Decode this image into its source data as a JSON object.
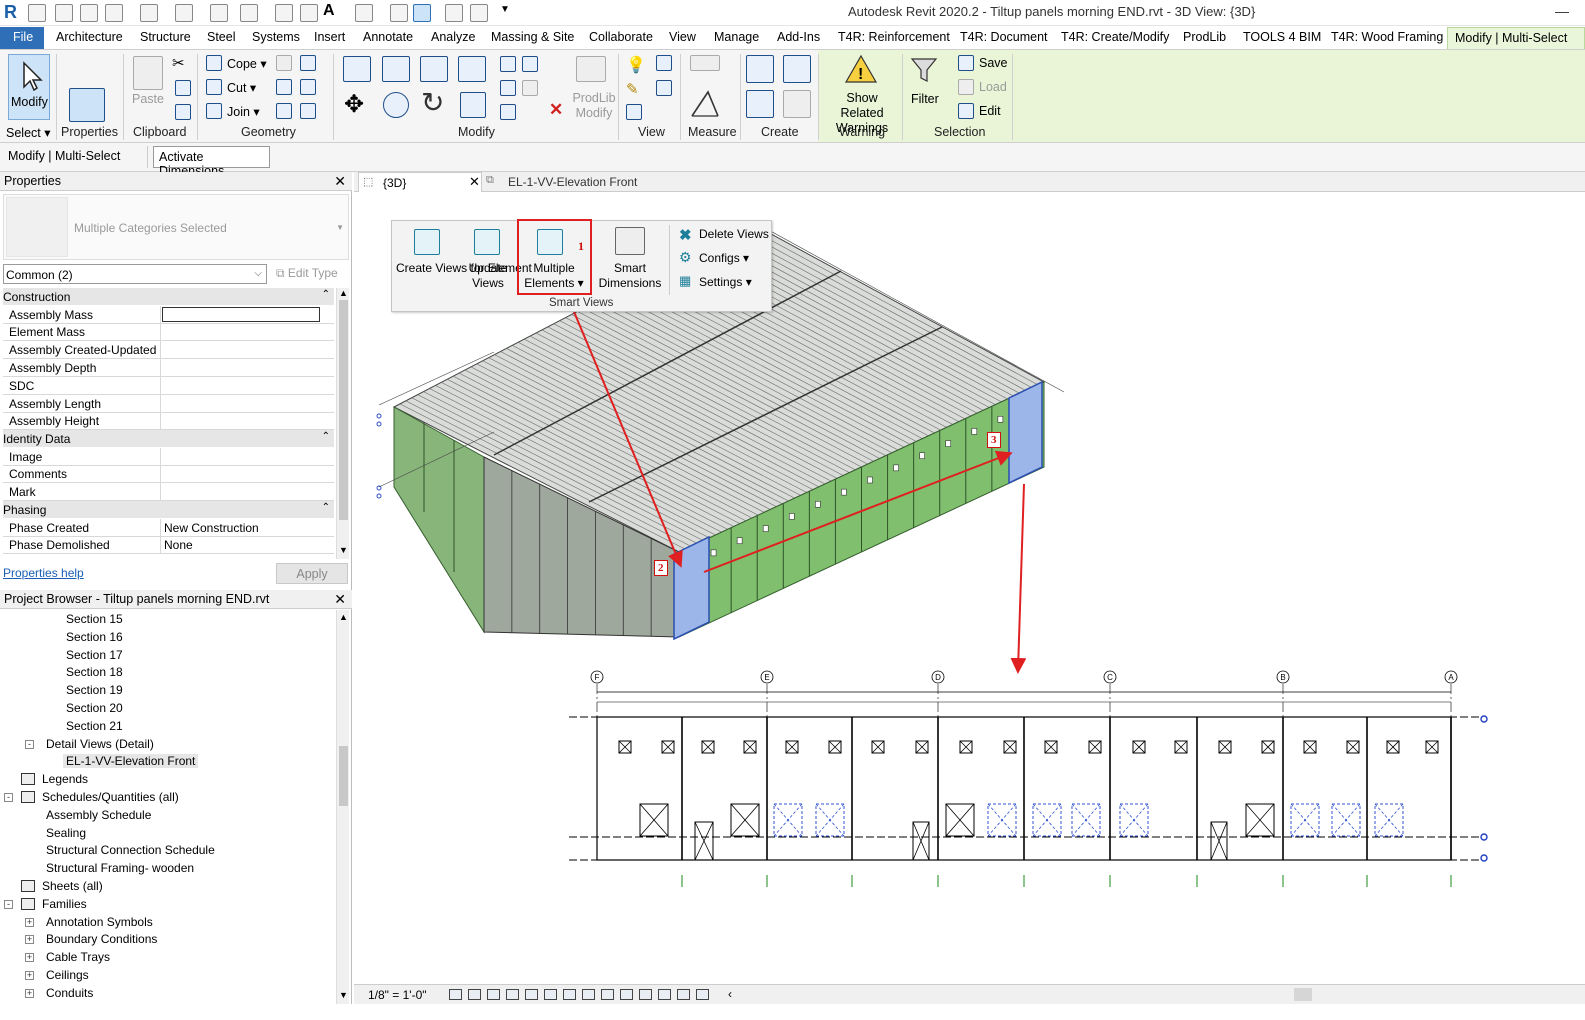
{
  "window": {
    "title": "Autodesk Revit 2020.2 - Tiltup panels morning END.rvt - 3D View: {3D}"
  },
  "tabs": [
    "File",
    "Architecture",
    "Structure",
    "Steel",
    "Systems",
    "Insert",
    "Annotate",
    "Analyze",
    "Massing & Site",
    "Collaborate",
    "View",
    "Manage",
    "Add-Ins",
    "T4R: Reinforcement",
    "T4R: Document",
    "T4R: Create/Modify",
    "ProdLib",
    "TOOLS 4 BIM",
    "T4R: Wood Framing",
    "Modify | Multi-Select"
  ],
  "ribbon": {
    "modify": "Modify",
    "select": "Select",
    "properties": "Properties",
    "paste": "Paste",
    "clipboard": "Clipboard",
    "cope": "Cope",
    "cut": "Cut",
    "join": "Join",
    "geometry": "Geometry",
    "prodlib_modify": "ProdLib Modify",
    "modify_group": "Modify",
    "view": "View",
    "measure": "Measure",
    "create": "Create",
    "show_related_warnings": "Show Related Warnings",
    "warning": "Warning",
    "filter": "Filter",
    "save": "Save",
    "load": "Load",
    "edit": "Edit",
    "selection": "Selection"
  },
  "optionsbar": {
    "context": "Modify | Multi-Select",
    "activate_dimensions": "Activate Dimensions"
  },
  "properties": {
    "title": "Properties",
    "type_selector": "Multiple Categories Selected",
    "filter": "Common (2)",
    "edit_type": "Edit Type",
    "categories": [
      {
        "name": "Construction",
        "rows": [
          {
            "k": "Assembly Mass",
            "v": ""
          },
          {
            "k": "Element Mass",
            "v": ""
          },
          {
            "k": "Assembly Created-Updated",
            "v": ""
          },
          {
            "k": "Assembly Depth",
            "v": ""
          },
          {
            "k": "SDC",
            "v": ""
          },
          {
            "k": "Assembly Length",
            "v": ""
          },
          {
            "k": "Assembly Height",
            "v": ""
          }
        ]
      },
      {
        "name": "Identity Data",
        "rows": [
          {
            "k": "Image",
            "v": ""
          },
          {
            "k": "Comments",
            "v": ""
          },
          {
            "k": "Mark",
            "v": ""
          }
        ]
      },
      {
        "name": "Phasing",
        "rows": [
          {
            "k": "Phase Created",
            "v": "New Construction"
          },
          {
            "k": "Phase Demolished",
            "v": "None"
          }
        ]
      }
    ],
    "help": "Properties help",
    "apply": "Apply"
  },
  "browser": {
    "title": "Project Browser - Tiltup panels morning END.rvt",
    "items": [
      {
        "label": "Section 15",
        "level": 3
      },
      {
        "label": "Section 16",
        "level": 3
      },
      {
        "label": "Section 17",
        "level": 3
      },
      {
        "label": "Section 18",
        "level": 3
      },
      {
        "label": "Section 19",
        "level": 3
      },
      {
        "label": "Section 20",
        "level": 3
      },
      {
        "label": "Section 21",
        "level": 3
      },
      {
        "label": "Detail Views (Detail)",
        "level": 2,
        "toggle": "-"
      },
      {
        "label": "EL-1-VV-Elevation Front",
        "level": 3,
        "selected": true
      },
      {
        "label": "Legends",
        "level": 1,
        "icon": true
      },
      {
        "label": "Schedules/Quantities (all)",
        "level": 1,
        "toggle": "-",
        "icon": true
      },
      {
        "label": "Assembly Schedule",
        "level": 2
      },
      {
        "label": "Sealing",
        "level": 2
      },
      {
        "label": "Structural Connection Schedule",
        "level": 2
      },
      {
        "label": "Structural Framing- wooden",
        "level": 2
      },
      {
        "label": "Sheets (all)",
        "level": 1,
        "icon": true
      },
      {
        "label": "Families",
        "level": 1,
        "toggle": "-",
        "icon": true
      },
      {
        "label": "Annotation Symbols",
        "level": 2,
        "toggle": "+"
      },
      {
        "label": "Boundary Conditions",
        "level": 2,
        "toggle": "+"
      },
      {
        "label": "Cable Trays",
        "level": 2,
        "toggle": "+"
      },
      {
        "label": "Ceilings",
        "level": 2,
        "toggle": "+"
      },
      {
        "label": "Conduits",
        "level": 2,
        "toggle": "+"
      }
    ]
  },
  "viewtabs": [
    {
      "label": "{3D}",
      "active": true
    },
    {
      "label": "EL-1-VV-Elevation Front",
      "active": false
    }
  ],
  "smartviews": {
    "create_views": "Create Views for Element",
    "update_views": "Update Views",
    "multiple_elements": "Multiple Elements",
    "smart_dimensions": "Smart Dimensions",
    "delete_views": "Delete Views",
    "configs": "Configs",
    "settings": "Settings",
    "group": "Smart Views"
  },
  "annotations": {
    "b1": "1",
    "b2": "2",
    "b3": "3"
  },
  "elevation": {
    "grids": [
      "F",
      "E",
      "D",
      "C",
      "B",
      "A"
    ]
  },
  "status": {
    "scale": "1/8\" = 1'-0\""
  },
  "colors": {
    "accent": "#2f6fb7",
    "context": "#eaf5d8",
    "model": "#5fa35a",
    "selected": "#8aa7e0",
    "annot": "#e02020"
  }
}
